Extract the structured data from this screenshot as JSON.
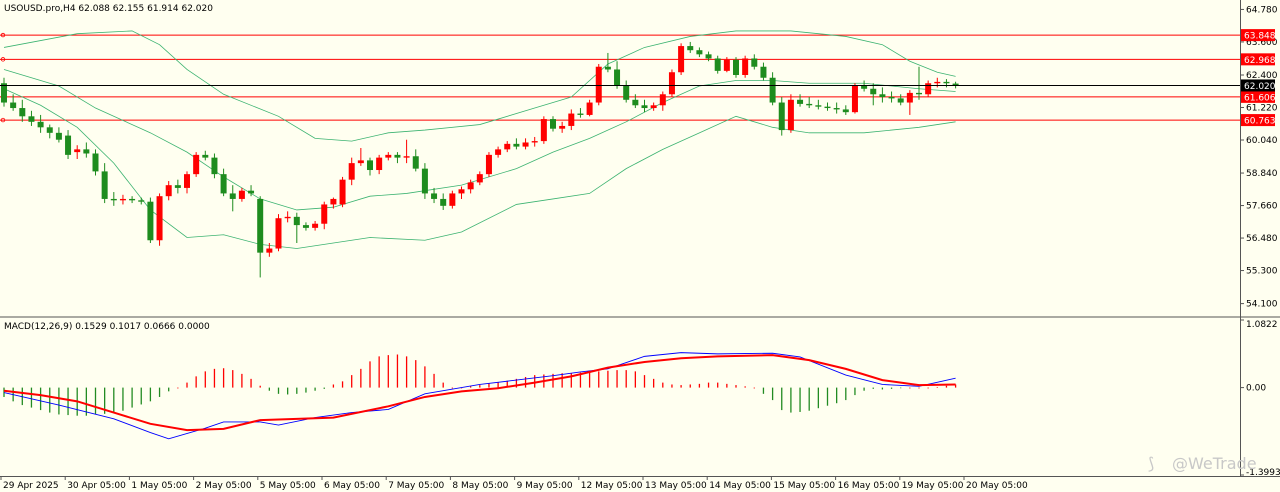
{
  "main_header": "USOUSD.pro,H4  62.088 62.155 61.914 62.020",
  "macd_header": "MACD(12,26,9) 0.1529 0.1017 0.0666 0.0000",
  "watermark": "@WeTrade",
  "colors": {
    "background": "#fffff0",
    "bull_candle": "#ff0000",
    "bear_candle": "#1e8c1e",
    "bollinger": "#3cb371",
    "hline": "#ff0000",
    "hist_pos": "#ff0000",
    "hist_neg": "#228b22",
    "macd_line": "#0000ff",
    "signal_line": "#ff0000"
  },
  "chart_data": [
    {
      "type": "candlestick",
      "symbol": "USOUSD.pro",
      "timeframe": "H4",
      "ohlc_header": {
        "open": 62.088,
        "high": 62.155,
        "low": 61.914,
        "close": 62.02
      },
      "x_labels": [
        "29 Apr 2025",
        "30 Apr 05:00",
        "1 May 05:00",
        "2 May 05:00",
        "5 May 05:00",
        "6 May 05:00",
        "7 May 05:00",
        "8 May 05:00",
        "9 May 05:00",
        "12 May 05:00",
        "13 May 05:00",
        "14 May 05:00",
        "15 May 05:00",
        "16 May 05:00",
        "19 May 05:00",
        "20 May 05:00"
      ],
      "y_ticks": [
        64.78,
        63.6,
        62.4,
        61.22,
        60.04,
        58.84,
        57.66,
        56.48,
        55.3,
        54.1
      ],
      "ylim": [
        53.65,
        65.05
      ],
      "current_price": 62.02,
      "price_levels": [
        63.848,
        62.968,
        61.606,
        60.763
      ],
      "candles": [
        [
          62.1,
          62.3,
          61.25,
          61.4
        ],
        [
          61.4,
          61.7,
          61.1,
          61.2
        ],
        [
          61.2,
          61.5,
          60.7,
          60.9
        ],
        [
          60.9,
          61.1,
          60.55,
          60.7
        ],
        [
          60.7,
          60.95,
          60.3,
          60.5
        ],
        [
          60.5,
          60.6,
          60.1,
          60.3
        ],
        [
          60.3,
          60.5,
          59.95,
          60.05
        ],
        [
          60.2,
          60.4,
          59.35,
          59.5
        ],
        [
          59.6,
          59.85,
          59.35,
          59.7
        ],
        [
          59.7,
          59.95,
          59.4,
          59.55
        ],
        [
          59.55,
          59.7,
          58.75,
          58.9
        ],
        [
          58.9,
          59.2,
          57.75,
          57.9
        ],
        [
          57.9,
          58.15,
          57.65,
          57.85
        ],
        [
          57.85,
          58.05,
          57.7,
          57.9
        ],
        [
          57.9,
          58.0,
          57.75,
          57.85
        ],
        [
          57.85,
          57.95,
          57.7,
          57.8
        ],
        [
          57.8,
          57.95,
          56.3,
          56.4
        ],
        [
          56.4,
          58.1,
          56.2,
          58.0
        ],
        [
          58.0,
          58.55,
          57.85,
          58.4
        ],
        [
          58.4,
          58.6,
          58.1,
          58.3
        ],
        [
          58.3,
          58.9,
          58.1,
          58.8
        ],
        [
          58.8,
          59.6,
          58.7,
          59.5
        ],
        [
          59.5,
          59.65,
          59.3,
          59.4
        ],
        [
          59.4,
          59.55,
          58.65,
          58.8
        ],
        [
          58.8,
          59.0,
          58.0,
          58.1
        ],
        [
          58.1,
          58.4,
          57.45,
          57.9
        ],
        [
          57.9,
          58.3,
          57.8,
          58.2
        ],
        [
          58.2,
          58.4,
          58.0,
          58.1
        ],
        [
          57.9,
          58.0,
          55.05,
          55.95
        ],
        [
          55.95,
          56.3,
          55.8,
          56.1
        ],
        [
          56.1,
          57.35,
          56.0,
          57.2
        ],
        [
          57.2,
          57.45,
          57.05,
          57.25
        ],
        [
          57.25,
          57.4,
          56.3,
          56.95
        ],
        [
          56.95,
          57.05,
          56.75,
          56.85
        ],
        [
          56.85,
          57.1,
          56.75,
          57.0
        ],
        [
          57.0,
          57.8,
          56.8,
          57.7
        ],
        [
          57.7,
          57.95,
          57.55,
          57.9
        ],
        [
          57.7,
          58.7,
          57.6,
          58.6
        ],
        [
          58.6,
          59.4,
          58.4,
          59.2
        ],
        [
          59.2,
          59.75,
          59.1,
          59.3
        ],
        [
          59.3,
          59.4,
          58.75,
          58.95
        ],
        [
          58.95,
          59.5,
          58.8,
          59.4
        ],
        [
          59.4,
          59.6,
          59.3,
          59.5
        ],
        [
          59.5,
          59.6,
          59.2,
          59.4
        ],
        [
          59.4,
          60.05,
          59.2,
          59.45
        ],
        [
          59.45,
          59.7,
          58.9,
          59.0
        ],
        [
          59.0,
          59.2,
          57.9,
          58.1
        ],
        [
          58.1,
          58.3,
          57.75,
          57.9
        ],
        [
          57.9,
          58.1,
          57.5,
          57.65
        ],
        [
          57.65,
          58.2,
          57.55,
          58.1
        ],
        [
          58.1,
          58.35,
          57.9,
          58.25
        ],
        [
          58.25,
          58.6,
          58.1,
          58.5
        ],
        [
          58.5,
          58.9,
          58.4,
          58.8
        ],
        [
          58.8,
          59.6,
          58.7,
          59.5
        ],
        [
          59.5,
          59.8,
          59.4,
          59.7
        ],
        [
          59.7,
          60.0,
          59.6,
          59.9
        ],
        [
          59.9,
          60.1,
          59.7,
          59.8
        ],
        [
          59.8,
          60.1,
          59.7,
          59.95
        ],
        [
          59.95,
          60.15,
          59.8,
          60.0
        ],
        [
          60.0,
          60.9,
          59.9,
          60.8
        ],
        [
          60.8,
          60.9,
          60.35,
          60.45
        ],
        [
          60.45,
          60.7,
          60.3,
          60.55
        ],
        [
          60.55,
          61.15,
          60.4,
          61.0
        ],
        [
          61.0,
          61.2,
          60.85,
          60.95
        ],
        [
          60.95,
          61.5,
          60.9,
          61.4
        ],
        [
          61.4,
          62.8,
          61.3,
          62.7
        ],
        [
          62.7,
          63.2,
          62.5,
          62.6
        ],
        [
          62.6,
          62.9,
          61.9,
          62.0
        ],
        [
          62.0,
          62.2,
          61.4,
          61.5
        ],
        [
          61.5,
          61.7,
          61.2,
          61.3
        ],
        [
          61.3,
          61.5,
          61.05,
          61.2
        ],
        [
          61.2,
          61.4,
          61.1,
          61.3
        ],
        [
          61.3,
          61.8,
          61.1,
          61.7
        ],
        [
          61.7,
          62.6,
          61.6,
          62.5
        ],
        [
          62.5,
          63.55,
          62.4,
          63.45
        ],
        [
          63.45,
          63.6,
          63.2,
          63.3
        ],
        [
          63.3,
          63.4,
          63.05,
          63.15
        ],
        [
          63.15,
          63.25,
          62.9,
          63.0
        ],
        [
          63.0,
          63.1,
          62.45,
          62.55
        ],
        [
          62.55,
          63.05,
          62.5,
          62.95
        ],
        [
          62.95,
          63.05,
          62.3,
          62.4
        ],
        [
          62.4,
          63.1,
          62.3,
          63.0
        ],
        [
          63.0,
          63.15,
          62.6,
          62.7
        ],
        [
          62.7,
          62.85,
          62.2,
          62.3
        ],
        [
          62.3,
          62.5,
          61.3,
          61.4
        ],
        [
          61.4,
          61.6,
          60.2,
          60.4
        ],
        [
          60.4,
          61.7,
          60.3,
          61.5
        ],
        [
          61.5,
          61.7,
          61.25,
          61.35
        ],
        [
          61.35,
          61.6,
          61.2,
          61.3
        ],
        [
          61.3,
          61.5,
          61.15,
          61.25
        ],
        [
          61.25,
          61.4,
          61.1,
          61.2
        ],
        [
          61.2,
          61.4,
          61.0,
          61.15
        ],
        [
          61.15,
          61.3,
          60.95,
          61.05
        ],
        [
          61.05,
          62.1,
          61.0,
          62.0
        ],
        [
          62.0,
          62.2,
          61.8,
          61.9
        ],
        [
          61.9,
          62.1,
          61.3,
          61.7
        ],
        [
          61.7,
          61.95,
          61.4,
          61.6
        ],
        [
          61.6,
          61.8,
          61.4,
          61.55
        ],
        [
          61.55,
          61.7,
          61.3,
          61.4
        ],
        [
          61.4,
          61.85,
          60.95,
          61.75
        ],
        [
          61.75,
          62.7,
          61.5,
          61.7
        ],
        [
          61.7,
          62.2,
          61.6,
          62.1
        ],
        [
          62.1,
          62.3,
          61.95,
          62.15
        ],
        [
          62.15,
          62.25,
          61.95,
          62.1
        ],
        [
          62.088,
          62.155,
          61.914,
          62.02
        ]
      ],
      "bollinger": {
        "upper": [
          [
            0,
            63.4
          ],
          [
            8,
            63.9
          ],
          [
            14,
            64.0
          ],
          [
            17,
            63.5
          ],
          [
            20,
            62.6
          ],
          [
            24,
            61.7
          ],
          [
            30,
            60.9
          ],
          [
            34,
            60.1
          ],
          [
            38,
            60.0
          ],
          [
            42,
            60.3
          ],
          [
            46,
            60.4
          ],
          [
            52,
            60.6
          ],
          [
            58,
            61.2
          ],
          [
            62,
            61.6
          ],
          [
            66,
            62.8
          ],
          [
            70,
            63.4
          ],
          [
            75,
            63.8
          ],
          [
            80,
            64.0
          ],
          [
            86,
            64.0
          ],
          [
            92,
            63.8
          ],
          [
            96,
            63.5
          ],
          [
            99,
            62.9
          ],
          [
            102,
            62.5
          ],
          [
            104,
            62.35
          ]
        ],
        "middle": [
          [
            0,
            62.6
          ],
          [
            6,
            62.0
          ],
          [
            10,
            61.2
          ],
          [
            16,
            60.3
          ],
          [
            20,
            59.6
          ],
          [
            24,
            58.7
          ],
          [
            28,
            57.9
          ],
          [
            32,
            57.5
          ],
          [
            36,
            57.6
          ],
          [
            40,
            58.0
          ],
          [
            44,
            58.1
          ],
          [
            50,
            58.4
          ],
          [
            56,
            59.0
          ],
          [
            60,
            59.6
          ],
          [
            64,
            60.1
          ],
          [
            68,
            60.7
          ],
          [
            72,
            61.4
          ],
          [
            76,
            62.0
          ],
          [
            80,
            62.2
          ],
          [
            84,
            62.2
          ],
          [
            88,
            62.1
          ],
          [
            94,
            62.1
          ],
          [
            100,
            61.9
          ],
          [
            104,
            61.8
          ]
        ],
        "lower": [
          [
            0,
            61.9
          ],
          [
            4,
            61.3
          ],
          [
            8,
            60.5
          ],
          [
            12,
            59.2
          ],
          [
            16,
            57.5
          ],
          [
            20,
            56.5
          ],
          [
            24,
            56.6
          ],
          [
            28,
            56.25
          ],
          [
            32,
            56.1
          ],
          [
            36,
            56.3
          ],
          [
            40,
            56.5
          ],
          [
            46,
            56.4
          ],
          [
            50,
            56.7
          ],
          [
            56,
            57.7
          ],
          [
            60,
            57.9
          ],
          [
            64,
            58.1
          ],
          [
            68,
            59.0
          ],
          [
            72,
            59.7
          ],
          [
            76,
            60.3
          ],
          [
            80,
            60.9
          ],
          [
            84,
            60.5
          ],
          [
            88,
            60.3
          ],
          [
            94,
            60.3
          ],
          [
            100,
            60.5
          ],
          [
            104,
            60.7
          ]
        ]
      }
    },
    {
      "type": "macd",
      "params": "12,26,9",
      "values": {
        "macd": 0.1529,
        "signal": 0.1017,
        "histogram": 0.0666
      },
      "y_ticks": [
        1.0822,
        0.0,
        -1.3993
      ],
      "ylim": [
        -1.3993,
        1.0822
      ],
      "histogram": [
        -0.15,
        -0.22,
        -0.28,
        -0.32,
        -0.36,
        -0.4,
        -0.43,
        -0.44,
        -0.45,
        -0.45,
        -0.43,
        -0.42,
        -0.4,
        -0.37,
        -0.32,
        -0.27,
        -0.22,
        -0.15,
        -0.06,
        0.0,
        0.08,
        0.18,
        0.26,
        0.3,
        0.31,
        0.28,
        0.22,
        0.14,
        0.03,
        -0.05,
        -0.1,
        -0.11,
        -0.1,
        -0.08,
        -0.05,
        -0.02,
        0.05,
        0.1,
        0.2,
        0.3,
        0.42,
        0.5,
        0.52,
        0.53,
        0.5,
        0.44,
        0.34,
        0.22,
        0.08,
        0.0,
        0.0,
        0.02,
        0.04,
        0.07,
        0.09,
        0.11,
        0.14,
        0.17,
        0.2,
        0.21,
        0.22,
        0.23,
        0.23,
        0.24,
        0.25,
        0.26,
        0.27,
        0.28,
        0.28,
        0.26,
        0.2,
        0.14,
        0.08,
        0.05,
        0.04,
        0.05,
        0.06,
        0.08,
        0.08,
        0.06,
        0.04,
        0.02,
        0.0,
        -0.1,
        -0.2,
        -0.36,
        -0.4,
        -0.39,
        -0.37,
        -0.33,
        -0.29,
        -0.25,
        -0.2,
        -0.12,
        -0.05,
        -0.02,
        -0.03,
        -0.02,
        -0.01,
        0.0,
        0.0,
        0.0,
        0.01,
        0.03,
        0.05
      ],
      "macd_line": [
        [
          0,
          -0.08
        ],
        [
          6,
          -0.28
        ],
        [
          12,
          -0.5
        ],
        [
          16,
          -0.72
        ],
        [
          18,
          -0.82
        ],
        [
          22,
          -0.65
        ],
        [
          24,
          -0.55
        ],
        [
          28,
          -0.55
        ],
        [
          30,
          -0.6
        ],
        [
          34,
          -0.48
        ],
        [
          38,
          -0.4
        ],
        [
          42,
          -0.35
        ],
        [
          46,
          -0.1
        ],
        [
          50,
          0.0
        ],
        [
          52,
          0.05
        ],
        [
          56,
          0.12
        ],
        [
          60,
          0.19
        ],
        [
          63,
          0.25
        ],
        [
          66,
          0.3
        ],
        [
          70,
          0.5
        ],
        [
          74,
          0.56
        ],
        [
          78,
          0.54
        ],
        [
          84,
          0.55
        ],
        [
          87,
          0.49
        ],
        [
          92,
          0.2
        ],
        [
          96,
          0.05
        ],
        [
          100,
          0.02
        ],
        [
          104,
          0.15
        ]
      ],
      "signal_line": [
        [
          0,
          -0.05
        ],
        [
          4,
          -0.12
        ],
        [
          8,
          -0.22
        ],
        [
          12,
          -0.4
        ],
        [
          16,
          -0.58
        ],
        [
          20,
          -0.68
        ],
        [
          24,
          -0.66
        ],
        [
          28,
          -0.52
        ],
        [
          32,
          -0.5
        ],
        [
          36,
          -0.48
        ],
        [
          42,
          -0.3
        ],
        [
          46,
          -0.15
        ],
        [
          50,
          -0.06
        ],
        [
          54,
          -0.01
        ],
        [
          58,
          0.08
        ],
        [
          62,
          0.18
        ],
        [
          66,
          0.32
        ],
        [
          70,
          0.41
        ],
        [
          74,
          0.47
        ],
        [
          78,
          0.5
        ],
        [
          84,
          0.52
        ],
        [
          88,
          0.44
        ],
        [
          92,
          0.3
        ],
        [
          96,
          0.12
        ],
        [
          100,
          0.04
        ],
        [
          104,
          0.05
        ]
      ]
    }
  ]
}
